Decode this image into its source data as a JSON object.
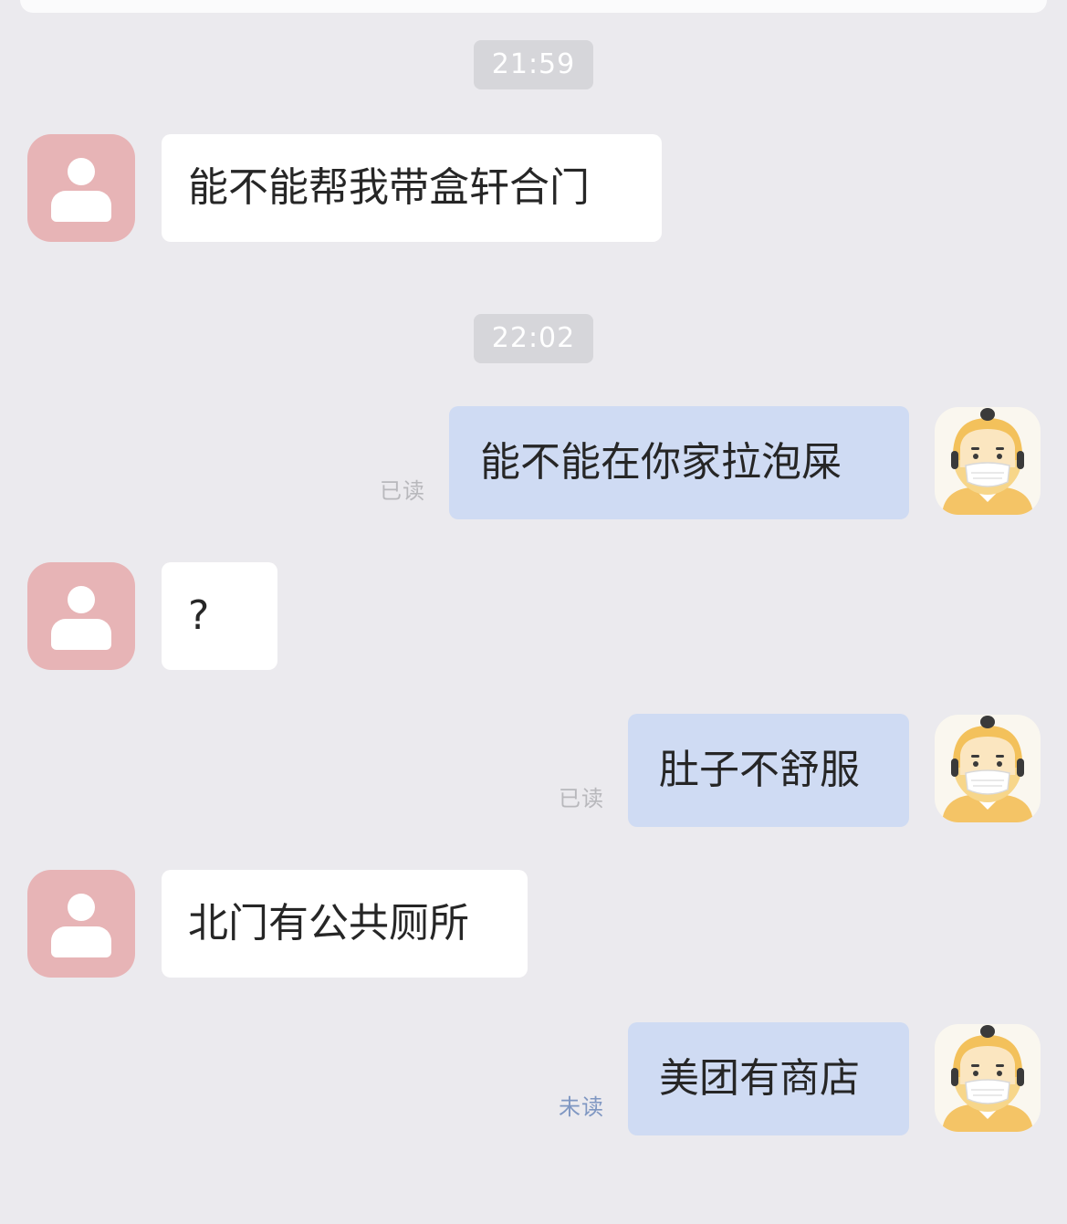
{
  "chat": {
    "timestamps": [
      "21:59",
      "22:02"
    ],
    "messages": [
      {
        "side": "in",
        "text": "能不能帮我带盒轩合门"
      },
      {
        "side": "out",
        "text": "能不能在你家拉泡屎",
        "status": "已读"
      },
      {
        "side": "in",
        "text": "?"
      },
      {
        "side": "out",
        "text": "肚子不舒服",
        "status": "已读"
      },
      {
        "side": "in",
        "text": "北门有公共厕所"
      },
      {
        "side": "out",
        "text": "美团有商店",
        "status": "未读"
      }
    ]
  },
  "colors": {
    "background": "#ebeaee",
    "incoming_bubble": "#ffffff",
    "outgoing_bubble": "#cfdbf3",
    "timestamp_bg": "#d6d6da",
    "default_avatar": "#e7b4b6",
    "read_text": "#b8b8bc",
    "unread_text": "#7f97c2"
  },
  "icons": {
    "contact_avatar": "person-icon",
    "self_avatar": "masked-cartoon-avatar"
  }
}
